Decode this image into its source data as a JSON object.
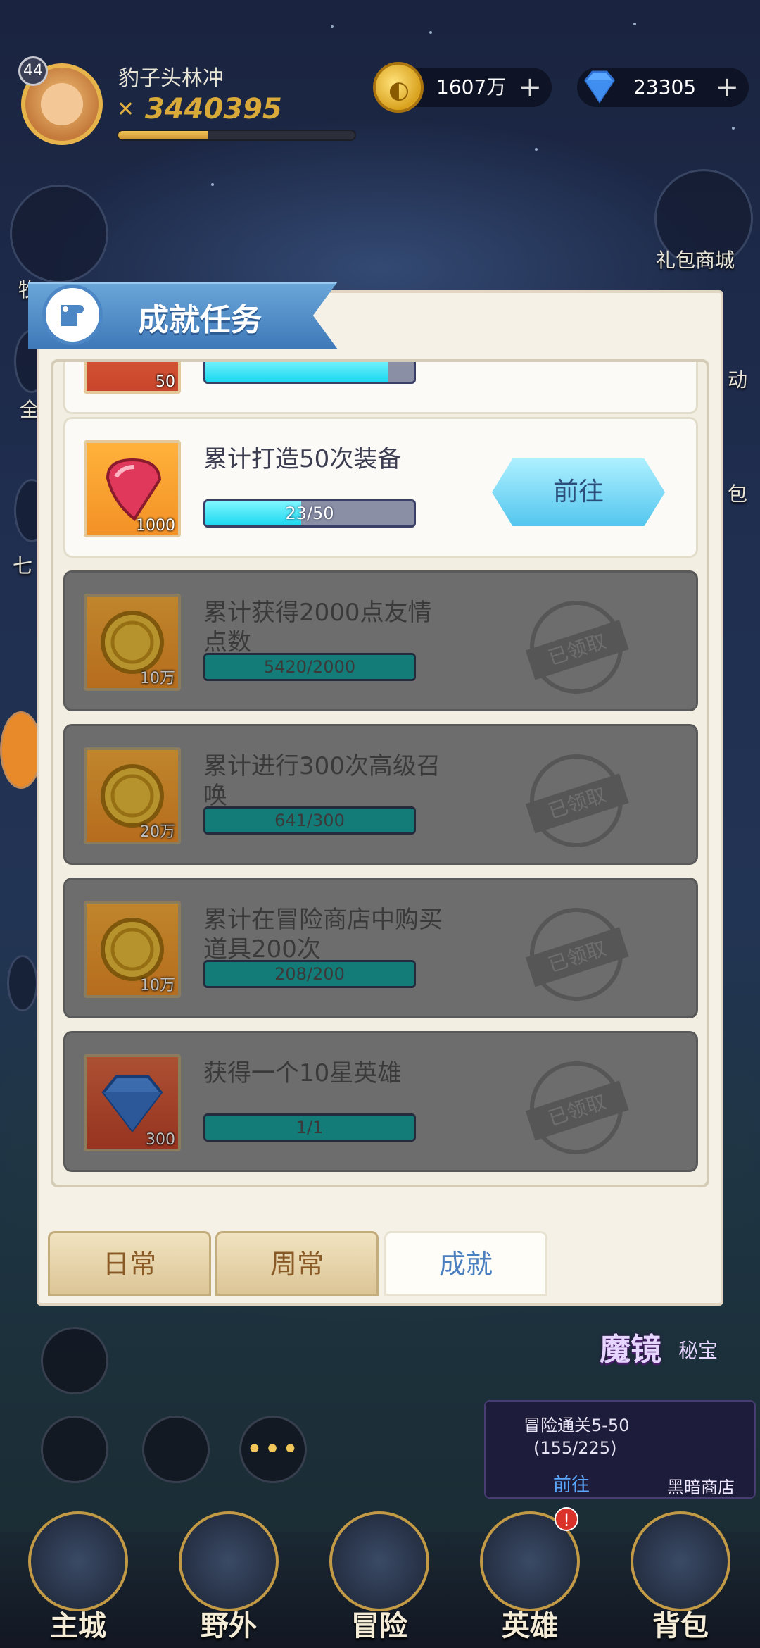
{
  "player": {
    "level": "44",
    "name": "豹子头林冲",
    "power": "3440395",
    "exp_fraction": 0.38
  },
  "currencies": {
    "gold": "1607万",
    "diamonds": "23305"
  },
  "side": {
    "gift_shop": "礼包商城",
    "activity": "动",
    "left_partial_1": "牧",
    "left_partial_2": "全",
    "left_partial_3": "七",
    "right_partial_1": "包"
  },
  "panel": {
    "title": "成就任务",
    "partial_top_reward": "50",
    "tasks": [
      {
        "title": "累计打造50次装备",
        "progress": "23/50",
        "progress_fraction": 0.46,
        "reward_amount": "1000",
        "reward_icon": "ruby-gem-icon",
        "action": "前往",
        "done": false
      },
      {
        "title": "累计获得2000点友情点数",
        "progress": "5420/2000",
        "progress_fraction": 1,
        "reward_amount": "10万",
        "reward_icon": "gold-coin-icon",
        "action": "已领取",
        "done": true
      },
      {
        "title": "累计进行300次高级召唤",
        "progress": "641/300",
        "progress_fraction": 1,
        "reward_amount": "20万",
        "reward_icon": "gold-coin-icon",
        "action": "已领取",
        "done": true
      },
      {
        "title": "累计在冒险商店中购买道具200次",
        "progress": "208/200",
        "progress_fraction": 1,
        "reward_amount": "10万",
        "reward_icon": "gold-coin-icon",
        "action": "已领取",
        "done": true
      },
      {
        "title": "获得一个10星英雄",
        "progress": "1/1",
        "progress_fraction": 1,
        "reward_amount": "300",
        "reward_icon": "blue-diamond-icon",
        "action": "已领取",
        "done": true
      }
    ],
    "tabs": [
      "日常",
      "周常",
      "成就"
    ]
  },
  "widgets": {
    "mirror_title": "魔镜",
    "mirror_sub": "秘宝",
    "quest_name": "冒险通关5-50",
    "quest_count": "(155/225)",
    "quest_go": "前往",
    "dark_shop": "黑暗商店"
  },
  "nav": [
    "主城",
    "野外",
    "冒险",
    "英雄",
    "背包"
  ],
  "colors": {
    "accent_blue": "#53c6ee",
    "panel_bg": "#f6f1e6",
    "done_card": "#6d6d6d",
    "tab_active_text": "#4a7fc0"
  }
}
